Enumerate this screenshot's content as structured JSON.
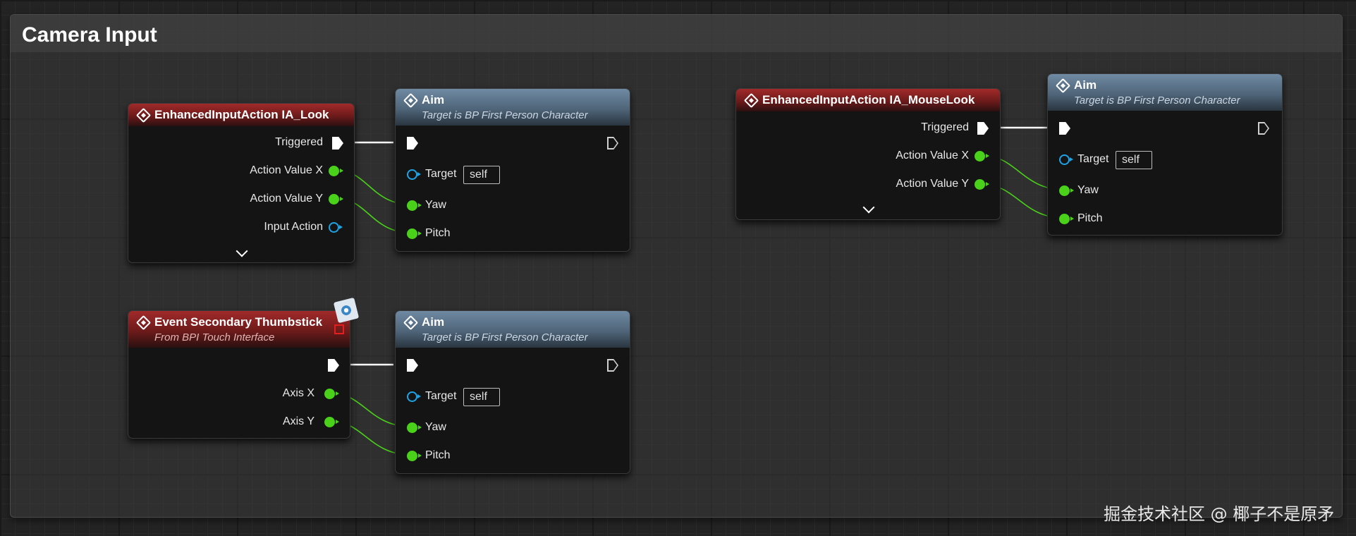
{
  "comment": {
    "title": "Camera Input"
  },
  "nodes": {
    "ia_look": {
      "title": "EnhancedInputAction IA_Look",
      "pins": {
        "triggered": "Triggered",
        "action_x": "Action Value X",
        "action_y": "Action Value Y",
        "input_action": "Input Action"
      }
    },
    "aim1": {
      "title": "Aim",
      "subtitle": "Target is BP First Person Character",
      "pins": {
        "target": "Target",
        "target_value": "self",
        "yaw": "Yaw",
        "pitch": "Pitch"
      }
    },
    "thumbstick": {
      "title": "Event Secondary Thumbstick",
      "subtitle": "From BPI Touch Interface",
      "pins": {
        "axis_x": "Axis X",
        "axis_y": "Axis Y"
      }
    },
    "aim2": {
      "title": "Aim",
      "subtitle": "Target is BP First Person Character",
      "pins": {
        "target": "Target",
        "target_value": "self",
        "yaw": "Yaw",
        "pitch": "Pitch"
      }
    },
    "ia_mouselook": {
      "title": "EnhancedInputAction IA_MouseLook",
      "pins": {
        "triggered": "Triggered",
        "action_x": "Action Value X",
        "action_y": "Action Value Y"
      }
    },
    "aim3": {
      "title": "Aim",
      "subtitle": "Target is BP First Person Character",
      "pins": {
        "target": "Target",
        "target_value": "self",
        "yaw": "Yaw",
        "pitch": "Pitch"
      }
    }
  },
  "watermark": "掘金技术社区 @ 椰子不是原矛",
  "colors": {
    "event_header": "#8e2020",
    "function_header": "#5d7890",
    "exec_wire": "#ffffff",
    "float_pin": "#4ad21a",
    "object_pin": "#1ea3e6"
  },
  "icons": {
    "node": "function-diamond-icon",
    "interface": "interface-globe-icon",
    "expand": "chevron-down-icon"
  }
}
